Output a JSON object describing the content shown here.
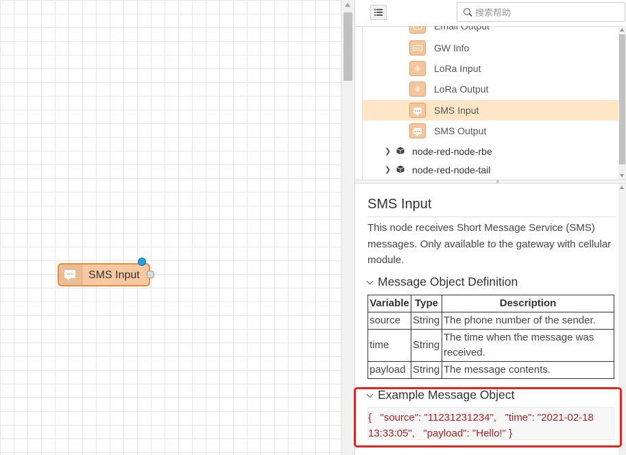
{
  "workspace": {
    "node": {
      "label": "SMS Input",
      "icon": "sms-icon",
      "fill": "#f8c9a0",
      "border": "#ef8a3a"
    }
  },
  "sidebar": {
    "toggle_icon": "list-icon",
    "search": {
      "placeholder": "搜索帮助",
      "value": ""
    },
    "tree": {
      "nodes": [
        {
          "label": "Email Output",
          "icon": "email-icon"
        },
        {
          "label": "GW Info",
          "icon": "gateway-icon"
        },
        {
          "label": "LoRa Input",
          "icon": "lora-icon"
        },
        {
          "label": "LoRa Output",
          "icon": "lora-icon"
        },
        {
          "label": "SMS Input",
          "icon": "sms-icon",
          "selected": true
        },
        {
          "label": "SMS Output",
          "icon": "sms-icon"
        }
      ],
      "packages": [
        {
          "label": "node-red-node-rbe",
          "icon": "package-icon"
        },
        {
          "label": "node-red-node-tail",
          "icon": "package-icon"
        }
      ]
    },
    "help": {
      "title": "SMS Input",
      "description": "This node receives Short Message Service (SMS) messages. Only available to the gateway with cellular module.",
      "section_definition": "Message Object Definition",
      "table": {
        "headers": [
          "Variable",
          "Type",
          "Description"
        ],
        "rows": [
          [
            "source",
            "String",
            "The phone number of the sender."
          ],
          [
            "time",
            "String",
            "The time when the message was received."
          ],
          [
            "payload",
            "String",
            "The message contents."
          ]
        ]
      },
      "section_example": "Example Message Object",
      "example_code": "{   \"source\": \"11231231234\",   \"time\": \"2021-02-18 13:33:05\",   \"payload\": \"Hello!\" }"
    }
  },
  "colors": {
    "highlight": "#e8231e",
    "selected_row": "#ffe6c6",
    "status_dot": "#1fa2e4"
  }
}
